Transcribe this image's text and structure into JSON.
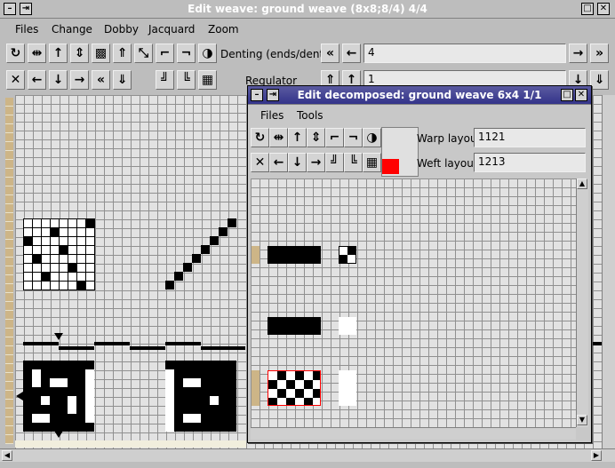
{
  "main_window": {
    "title": "Edit weave: ground weave (8x8;8/4) 4/4",
    "menu": [
      "Files",
      "Change",
      "Dobby",
      "Jacquard",
      "Zoom"
    ],
    "denting_label": "Denting (ends/dent)",
    "denting_value": "4",
    "regulator_label": "Regulator",
    "regulator_value": "1"
  },
  "sub_window": {
    "title": "Edit decomposed: ground weave 6x4 1/1",
    "menu": [
      "Files",
      "Tools"
    ],
    "warp_layout_label": "Warp layout",
    "warp_layout_value": "1121",
    "weft_layout_label": "Weft layout",
    "weft_layout_value": "1213",
    "selected_color": "#ff0000"
  },
  "icons": {
    "row1": [
      "rotate-icon",
      "mirror-horizontal-icon",
      "arrow-up-icon",
      "mirror-vertical-icon",
      "invert-pattern-icon",
      "double-arrow-up-icon",
      "diagonal-icon",
      "stair-up-icon",
      "stair-down-icon",
      "half-circle-icon"
    ],
    "row2": [
      "clear-icon",
      "arrow-left-icon",
      "arrow-down-icon",
      "arrow-right-icon",
      "double-arrow-left-icon",
      "double-arrow-down-icon",
      "stair-shift-up-icon",
      "stair-shift-down-icon",
      "checker-icon"
    ]
  }
}
